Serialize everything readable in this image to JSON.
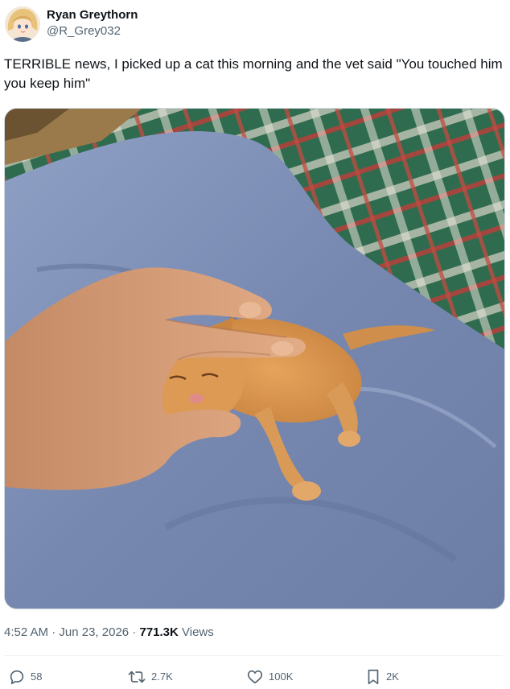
{
  "tweet": {
    "author": {
      "display_name": "Ryan Greythorn",
      "handle": "@R_Grey032",
      "avatar_icon": "anime-avatar"
    },
    "text": "TERRIBLE news, I picked up a cat this morning and the vet said \"You touched him you keep him\"",
    "media": {
      "description_icon": "photo-kitten"
    },
    "meta": {
      "time": "4:52 AM",
      "separator": " · ",
      "date": "Jun 23, 2026",
      "views_count": "771.3K",
      "views_label": " Views"
    },
    "actions": {
      "replies": "58",
      "reposts": "2.7K",
      "likes": "100K",
      "bookmarks": "2K"
    }
  },
  "colors": {
    "text_primary": "#0f1419",
    "text_secondary": "#536471",
    "border": "#cfd9de"
  }
}
